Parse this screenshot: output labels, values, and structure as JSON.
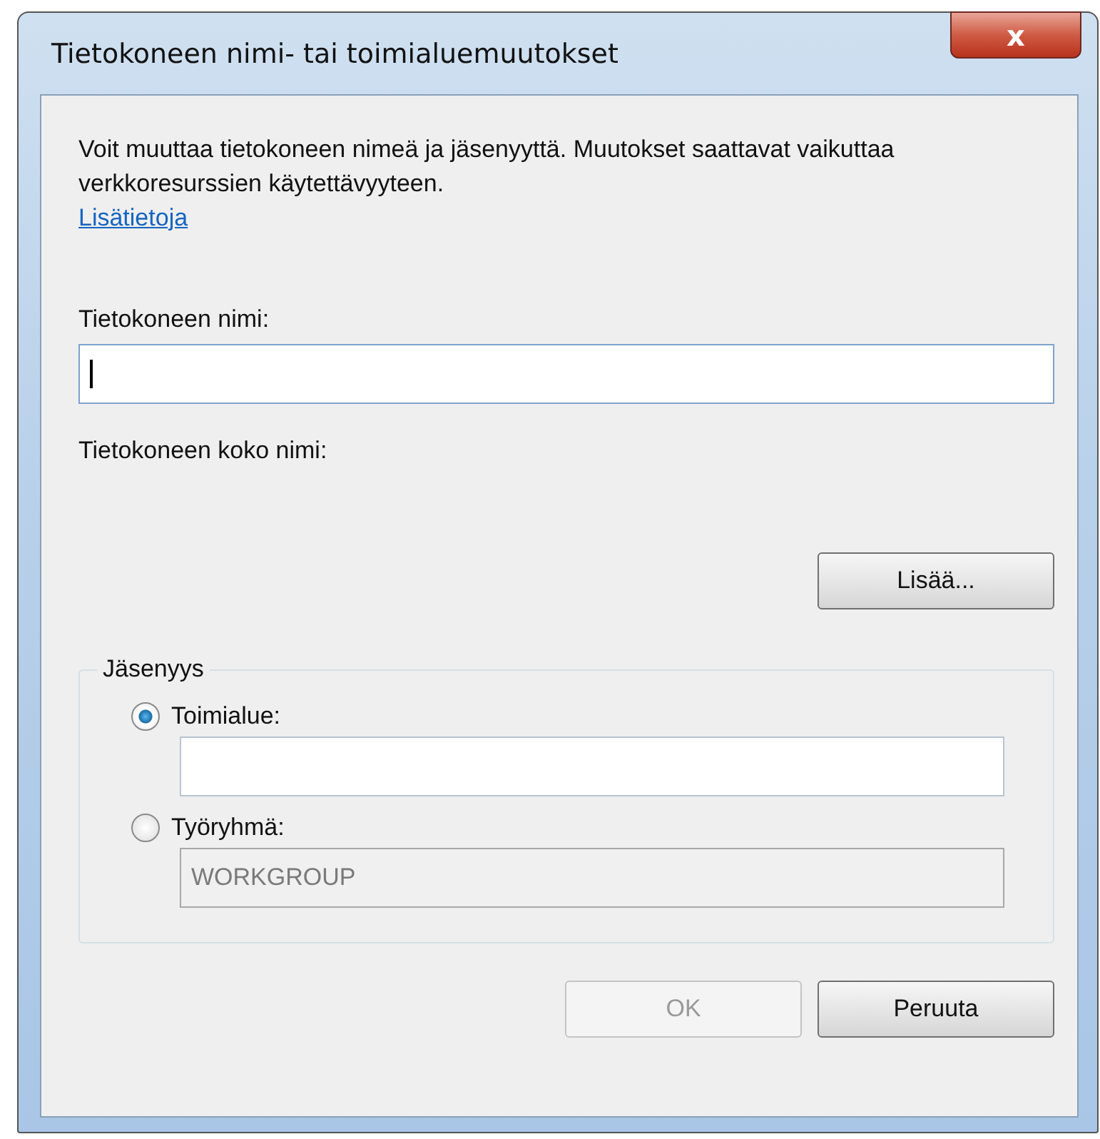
{
  "window": {
    "title": "Tietokoneen nimi- tai toimialuemuutokset",
    "close": "x"
  },
  "description": "Voit muuttaa tietokoneen nimeä ja jäsenyyttä. Muutokset saattavat vaikuttaa verkkoresurssien käytettävyyteen.",
  "link": "Lisätietoja",
  "computer_name": {
    "label": "Tietokoneen nimi:",
    "focused": true
  },
  "full_name": {
    "label": "Tietokoneen koko nimi:"
  },
  "more_button": {
    "label": "Lisää...",
    "disabled": false
  },
  "membership": {
    "legend": "Jäsenyys",
    "options": [
      {
        "label": "Toimialue:",
        "selected": true,
        "field": {
          "disabled": false
        }
      },
      {
        "label": "Työryhmä:",
        "selected": false,
        "field": {
          "value": "WORKGROUP",
          "disabled": true
        }
      }
    ]
  },
  "buttons": [
    {
      "label": "OK",
      "disabled": true
    },
    {
      "label": "Peruuta",
      "disabled": false
    }
  ]
}
